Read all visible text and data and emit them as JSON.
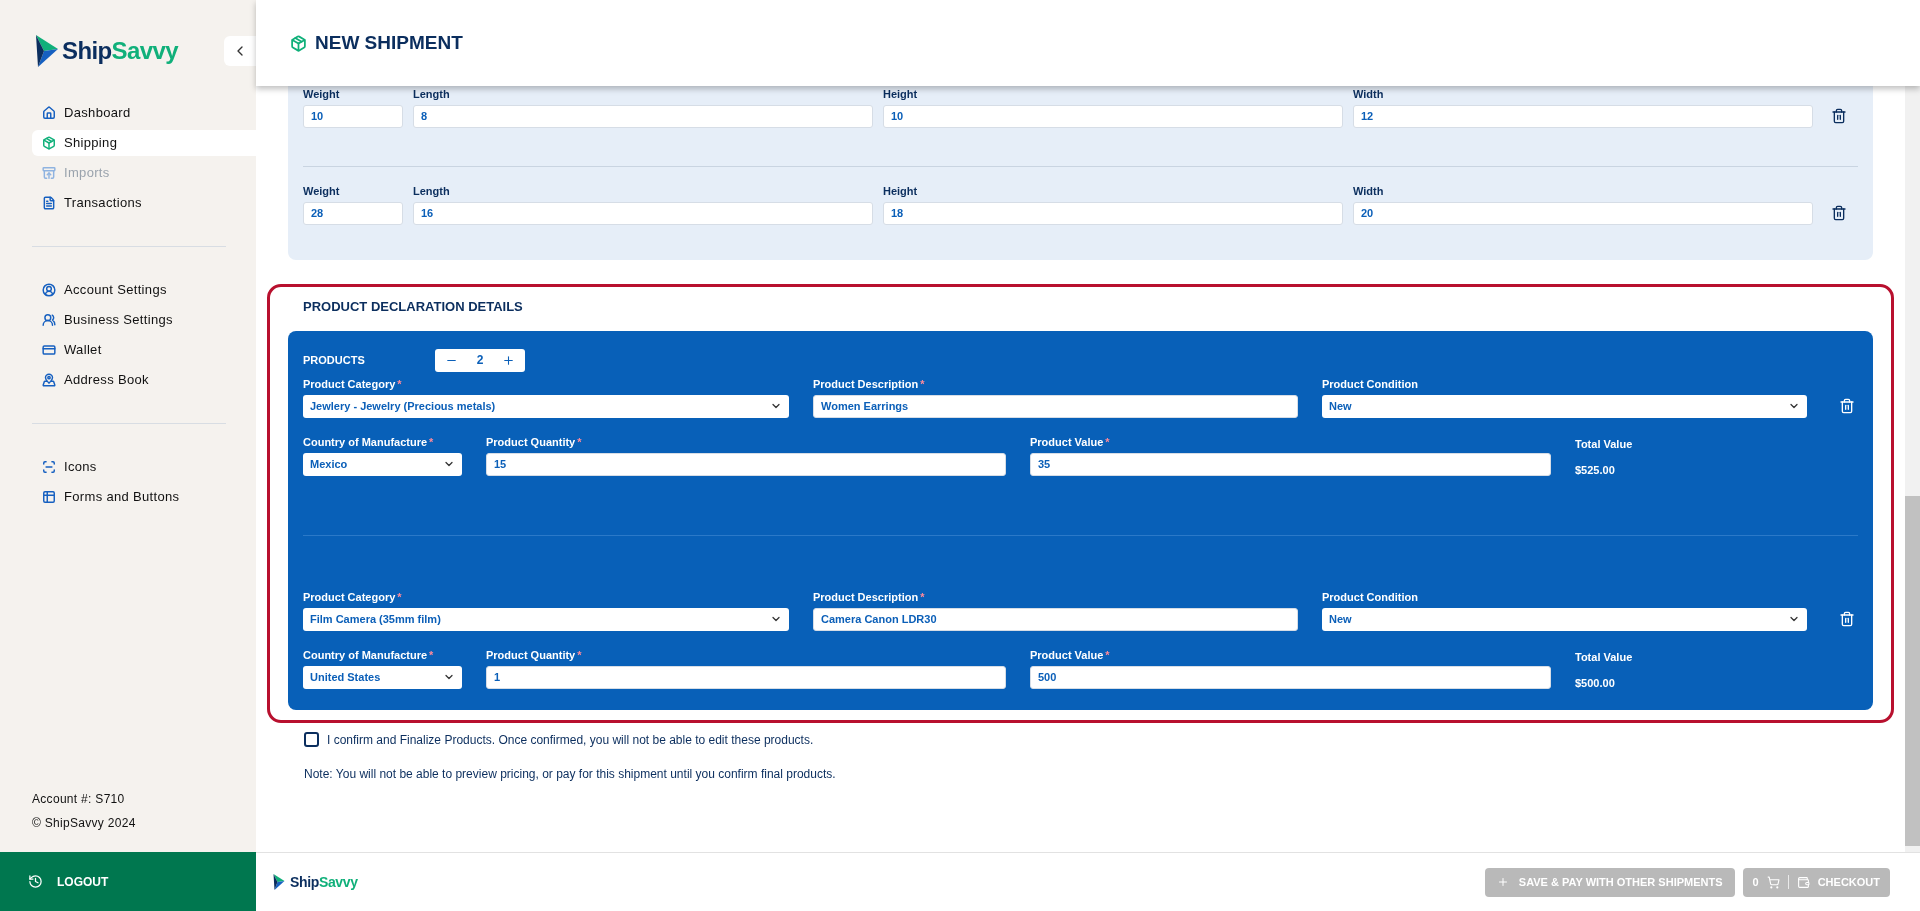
{
  "sidebar": {
    "brand_parts": [
      "Ship",
      "Savvy"
    ],
    "nav_groups": [
      [
        {
          "label": "Dashboard",
          "selected": false,
          "disabled": false
        },
        {
          "label": "Shipping",
          "selected": true,
          "disabled": false
        },
        {
          "label": "Imports",
          "selected": false,
          "disabled": true
        },
        {
          "label": "Transactions",
          "selected": false,
          "disabled": false
        }
      ],
      [
        {
          "label": "Account Settings",
          "selected": false,
          "disabled": false
        },
        {
          "label": "Business Settings",
          "selected": false,
          "disabled": false
        },
        {
          "label": "Wallet",
          "selected": false,
          "disabled": false
        },
        {
          "label": "Address Book",
          "selected": false,
          "disabled": false
        }
      ],
      [
        {
          "label": "Icons",
          "selected": false,
          "disabled": false
        },
        {
          "label": "Forms and Buttons",
          "selected": false,
          "disabled": false
        }
      ]
    ],
    "account": "Account #: S710",
    "copyright": "© ShipSavvy 2024",
    "logout": "LOGOUT"
  },
  "header": {
    "title": "NEW SHIPMENT"
  },
  "packages": [
    {
      "fields": [
        {
          "label": "Weight",
          "value": "10"
        },
        {
          "label": "Length",
          "value": "8"
        },
        {
          "label": "Height",
          "value": "10"
        },
        {
          "label": "Width",
          "value": "12"
        }
      ]
    },
    {
      "fields": [
        {
          "label": "Weight",
          "value": "28"
        },
        {
          "label": "Length",
          "value": "16"
        },
        {
          "label": "Height",
          "value": "18"
        },
        {
          "label": "Width",
          "value": "20"
        }
      ]
    }
  ],
  "product_declaration": {
    "title": "PRODUCT DECLARATION DETAILS",
    "products_label": "PRODUCTS",
    "count": "2",
    "products": [
      {
        "fields": [
          {
            "kind": "select",
            "label": "Product Category",
            "required_mark": "*",
            "value": "Jewlery - Jewelry (Precious metals)"
          },
          {
            "kind": "text",
            "label": "Product Description",
            "required_mark": "*",
            "value": "Women Earrings"
          },
          {
            "kind": "select",
            "label": "Product Condition",
            "value": "New"
          },
          {
            "kind": "select",
            "label": "Country of Manufacture",
            "required_mark": "*",
            "value": "Mexico"
          },
          {
            "kind": "text",
            "label": "Product Quantity",
            "required_mark": "*",
            "value": "15"
          },
          {
            "kind": "text",
            "label": "Product Value",
            "required_mark": "*",
            "value": "35"
          }
        ],
        "total": {
          "label": "Total Value",
          "value": "$525.00"
        }
      },
      {
        "fields": [
          {
            "kind": "select",
            "label": "Product Category",
            "required_mark": "*",
            "value": "Film Camera (35mm film)"
          },
          {
            "kind": "text",
            "label": "Product Description",
            "required_mark": "*",
            "value": "Camera Canon LDR30"
          },
          {
            "kind": "select",
            "label": "Product Condition",
            "value": "New"
          },
          {
            "kind": "select",
            "label": "Country of Manufacture",
            "required_mark": "*",
            "value": "United States"
          },
          {
            "kind": "text",
            "label": "Product Quantity",
            "required_mark": "*",
            "value": "1"
          },
          {
            "kind": "text",
            "label": "Product Value",
            "required_mark": "*",
            "value": "500"
          }
        ],
        "total": {
          "label": "Total Value",
          "value": "$500.00"
        }
      }
    ]
  },
  "confirm": {
    "label": "I confirm and Finalize Products. Once confirmed, you will not be able to edit these products.",
    "checked": false
  },
  "note": "Note: You will not be able to preview pricing, or pay for this shipment until you confirm final products.",
  "footer": {
    "brand_parts": [
      "Ship",
      "Savvy"
    ],
    "save_button": {
      "label": "SAVE & PAY WITH OTHER SHIPMENTS",
      "disabled": true
    },
    "cart_count": "0",
    "checkout_button": {
      "label": "CHECKOUT",
      "disabled": true
    }
  }
}
